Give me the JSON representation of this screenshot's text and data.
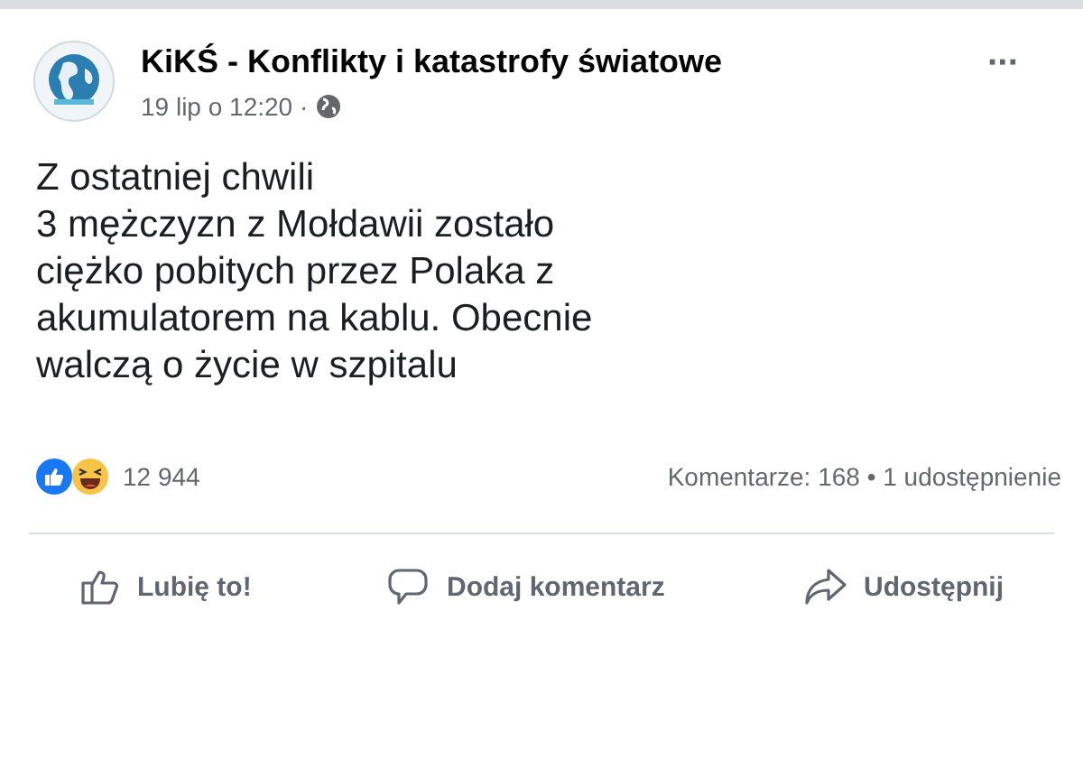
{
  "post": {
    "author": "KiKŚ - Konflikty i katastrofy światowe",
    "time": "19 lip o 12:20 ·",
    "more": "···",
    "text_lines": [
      "Z ostatniej chwili",
      "3 mężczyzn z Mołdawii zostało",
      "ciężko pobitych przez Polaka z",
      "akumulatorem na kablu. Obecnie",
      "walczą o życie w szpitalu"
    ],
    "reactions_count": "12 944",
    "stats": "Komentarze: 168 • 1 udostępnienie",
    "actions": [
      {
        "kind": "like",
        "label": "Lubię to!"
      },
      {
        "kind": "comment",
        "label": "Dodaj komentarz"
      },
      {
        "kind": "share",
        "label": "Udostępnij"
      }
    ]
  }
}
